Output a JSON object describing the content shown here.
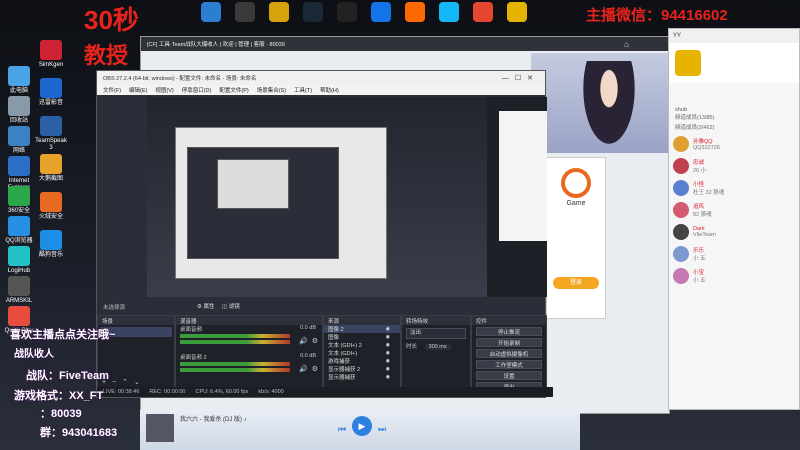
{
  "overlay": {
    "timer": "30秒",
    "tag": "教授",
    "wechat": "主播微信：94416602",
    "follow": "喜欢主播点点关注哦~",
    "recruit": "战队收人",
    "team": "战队：FiveTeam",
    "game_name": "游戏格式：XX_FT",
    "yy": "：80039",
    "qq_group": "群：943041683"
  },
  "desktop_icons": [
    {
      "label": "此电脑",
      "color": "#4aa3e6"
    },
    {
      "label": "回收站",
      "color": "#8899aa"
    },
    {
      "label": "网络",
      "color": "#3b82c4"
    },
    {
      "label": "Internet Explorer",
      "color": "#2d6fc6"
    },
    {
      "label": "360安全",
      "color": "#2aa84a"
    },
    {
      "label": "QQ浏览器",
      "color": "#2790e4"
    },
    {
      "label": "LogiHub",
      "color": "#23c2c6"
    },
    {
      "label": "ARMSKIL",
      "color": "#555"
    },
    {
      "label": "Quick Play",
      "color": "#e84c3d"
    }
  ],
  "desktop_icons_col2": [
    {
      "label": "SimKgen",
      "color": "#c23"
    },
    {
      "label": "迅雷影音",
      "color": "#1e66d0"
    },
    {
      "label": "TeamSpeak 3",
      "color": "#2b5fa6"
    },
    {
      "label": "大鹅截图",
      "color": "#e6a229"
    },
    {
      "label": "火绒安全",
      "color": "#e66a1f"
    },
    {
      "label": "酷狗音乐",
      "color": "#1c8ee6"
    }
  ],
  "taskbar_top": [
    {
      "label": "",
      "color": "#2c7fd0"
    },
    {
      "label": "",
      "color": "#3a3a3a"
    },
    {
      "label": "",
      "color": "#d8a20b"
    },
    {
      "label": "",
      "color": "#1b2838"
    },
    {
      "label": "",
      "color": "#222"
    },
    {
      "label": "",
      "color": "#1473e6"
    },
    {
      "label": "",
      "color": "#ff6a00"
    },
    {
      "label": "",
      "color": "#12b7f5"
    },
    {
      "label": "",
      "color": "#e6462f"
    },
    {
      "label": "",
      "color": "#e6b400"
    }
  ],
  "obs": {
    "title": "OBS 27.2.4 (64-bit, windows) - 配置文件: 未命名 - 场景: 未命名",
    "menu": [
      "文件(F)",
      "编辑(E)",
      "视图(V)",
      "停靠窗口(D)",
      "配置文件(P)",
      "场景集合(S)",
      "工具(T)",
      "帮助(H)"
    ],
    "no_source": "未选择源",
    "props": "属性",
    "filters": "滤镜",
    "docks": {
      "scenes": "场景",
      "mixer": "混音器",
      "sources": "来源",
      "transitions": "转场特效",
      "controls": "控件"
    },
    "mixer_tracks": [
      {
        "name": "桌面音频",
        "db": "0.0 dB"
      },
      {
        "name": "桌面音频 2",
        "db": "0.0 dB"
      }
    ],
    "sources": [
      "图像 2",
      "图像",
      "文本 (GDI+) 2",
      "文本 (GDI+)",
      "游戏捕获",
      "显示器捕获 2",
      "显示器捕获"
    ],
    "transition": {
      "type": "淡出",
      "duration_label": "时长",
      "duration": "300 ms"
    },
    "controls": [
      "停止推流",
      "开始录制",
      "启动虚拟摄像机",
      "工作室模式",
      "设置",
      "退出"
    ],
    "status": {
      "live": "LIVE: 00:38:46",
      "rec": "REC: 00:00:00",
      "cpu": "CPU: 6.4%, 60.00 fps",
      "kbps": "kb/s: 4000"
    }
  },
  "game_panel": {
    "brand": "Game",
    "login": "登录"
  },
  "chat": {
    "title": "YY",
    "channel": "shub",
    "sections": [
      "频道成员(13/85)",
      "频道成员(2/462)"
    ],
    "members": [
      {
        "name": "孙雅QQ",
        "note": "QQ322726",
        "color": "#e0a030"
      },
      {
        "name": "忠诚",
        "note": "26 小",
        "color": "#c04050"
      },
      {
        "name": "小怪",
        "note": "杜王 32 狼魂",
        "color": "#5a7fd0"
      },
      {
        "name": "追风",
        "note": "82 狼魂",
        "color": "#d45a70"
      },
      {
        "name": "Dark",
        "note": "ViteTeam",
        "color": "#444"
      },
      {
        "name": "乐乐",
        "note": "小 五",
        "color": "#7a9ad0"
      },
      {
        "name": "小宝",
        "note": "小 五",
        "color": "#c47ab0"
      }
    ]
  },
  "media": {
    "track": "我六六 - 我爱杀 (DJ 版) ♪"
  }
}
